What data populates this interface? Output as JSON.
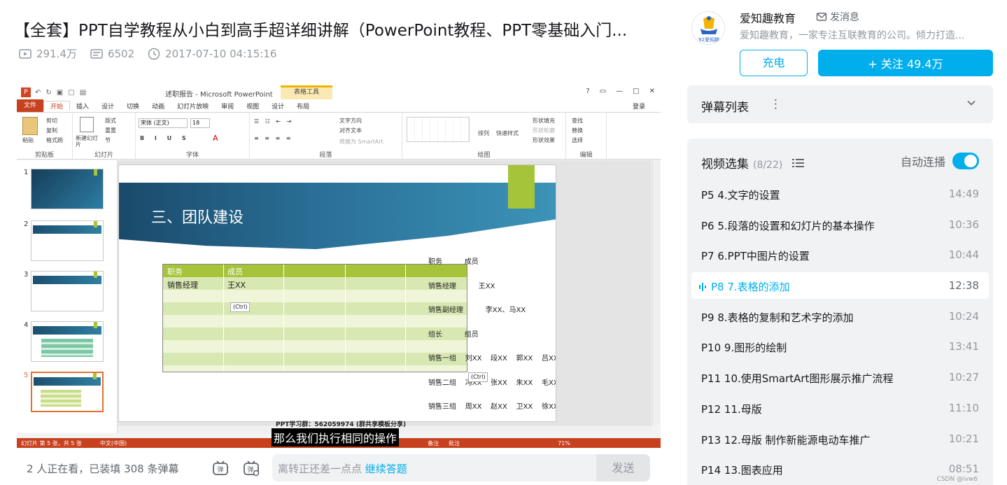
{
  "video": {
    "title": "【全套】PPT自学教程从小白到高手超详细讲解（PowerPoint教程、PPT零基础入门...",
    "views": "291.4万",
    "danmaku_count": "6502",
    "date": "2017-07-10 04:15:16"
  },
  "ppt": {
    "window_title": "述职报告 - Microsoft PowerPoint",
    "context_tab": "表格工具",
    "tabs": [
      "文件",
      "开始",
      "插入",
      "设计",
      "切换",
      "动画",
      "幻灯片放映",
      "审阅",
      "视图",
      "设计",
      "布局"
    ],
    "login": "登录",
    "ribbon": {
      "clipboard": {
        "label": "剪贴板",
        "paste": "粘贴",
        "cut": "剪切",
        "copy": "复制",
        "format": "格式刷"
      },
      "slides": {
        "label": "幻灯片",
        "new": "新建幻灯片",
        "layout": "版式",
        "reset": "重置",
        "section": "节"
      },
      "font": {
        "label": "字体",
        "name": "宋体 (正文)",
        "size": "18"
      },
      "paragraph": {
        "label": "段落",
        "dir": "文字方向",
        "align": "对齐文本",
        "smartart": "转换为 SmartArt"
      },
      "drawing": {
        "label": "绘图",
        "arrange": "排列",
        "quickstyle": "快速样式",
        "fill": "形状填充",
        "outline": "形状轮廓",
        "effect": "形状效果"
      },
      "editing": {
        "label": "编辑",
        "find": "查找",
        "replace": "替换",
        "select": "选择"
      }
    },
    "slide_numbers": [
      "1",
      "2",
      "3",
      "4",
      "5"
    ],
    "slide_heading": "三、团队建设",
    "table": {
      "headers": [
        "职务",
        "成员"
      ],
      "rows": [
        [
          "销售经理",
          "王XX"
        ]
      ]
    },
    "paste_label": "(Ctrl)",
    "pasted_text": [
      "职务          成员",
      "销售经理          王XX",
      "销售副经理          李XX、马XX",
      "组长          组员",
      "销售一组    刘XX    段XX    郭XX    吕XX",
      "销售二组    冯XX    张XX    朱XX    毛XX",
      "销售三组    周XX    赵XX    卫XX    徐XX"
    ],
    "status_left": "幻灯片 第 5 张，共 5 张",
    "status_lang": "中文(中国)",
    "status_notes": "备注",
    "status_comments": "批注",
    "zoom": "71%",
    "qq_group": "PPT学习群：562059974 (群共享模板分享)"
  },
  "subtitle": "那么我们执行相同的操作",
  "bottom": {
    "viewers": "2 人正在看，已装填 308 条弹幕",
    "placeholder": "离转正还差一点点",
    "placeholder_link": "继续答题",
    "send": "发送"
  },
  "uploader": {
    "name": "爱知趣教育",
    "message": "发消息",
    "description": "爱知趣教育，一家专注互联教育的公司。倾力打造...",
    "avatar_text": "92爱知趣",
    "charge": "充电",
    "follow": "+ 关注 49.4万"
  },
  "danmaku_list": {
    "label": "弹幕列表"
  },
  "playlist": {
    "title": "视频选集",
    "count": "(8/22)",
    "autoplay": "自动连播",
    "episodes": [
      {
        "label": "P5  4.文字的设置",
        "duration": "14:49"
      },
      {
        "label": "P6  5.段落的设置和幻灯片的基本操作",
        "duration": "10:36"
      },
      {
        "label": "P7  6.PPT中图片的设置",
        "duration": "10:44"
      },
      {
        "label": "P8  7.表格的添加",
        "duration": "12:38"
      },
      {
        "label": "P9  8.表格的复制和艺术字的添加",
        "duration": "10:24"
      },
      {
        "label": "P10  9.图形的绘制",
        "duration": "13:41"
      },
      {
        "label": "P11  10.使用SmartArt图形展示推广流程",
        "duration": "10:27"
      },
      {
        "label": "P12  11.母版",
        "duration": "11:10"
      },
      {
        "label": "P13  12.母版 制作新能源电动车推广",
        "duration": "10:21"
      },
      {
        "label": "P14  13.图表应用",
        "duration": "08:51"
      }
    ]
  },
  "watermark": "CSDN @ivw6",
  "colors": {
    "accent": "#00aeec",
    "ppt_red": "#c8411f",
    "table_green": "#a5c43a"
  }
}
